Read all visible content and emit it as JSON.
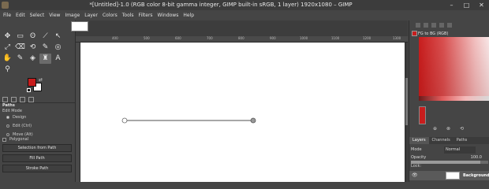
{
  "window": {
    "title": "*[Untitled]-1.0 (RGB color 8-bit gamma integer, GIMP built-in sRGB, 1 layer) 1920x1080 – GIMP",
    "controls": [
      "–",
      "□",
      "✕"
    ]
  },
  "menu": [
    "File",
    "Edit",
    "Select",
    "View",
    "Image",
    "Layer",
    "Colors",
    "Tools",
    "Filters",
    "Windows",
    "Help"
  ],
  "toolbox": {
    "tools": [
      "✥",
      "▭",
      "ʘ",
      "⟋",
      "↖",
      "⤢",
      "⌫",
      "⟲",
      "✎",
      "◎",
      "✋",
      "✎",
      "◈",
      "♜",
      "A",
      "⚲",
      "",
      "",
      "",
      ""
    ],
    "active_tool_index": 13,
    "fg_color": "#c81d1d",
    "bg_color": "#ffffff"
  },
  "tool_options": {
    "title": "Paths",
    "edit_mode_label": "Edit Mode",
    "modes": [
      "Design",
      "Edit (Ctrl)",
      "Move (Alt)"
    ],
    "polygonal_label": "Polygonal",
    "buttons": [
      "Selection from Path",
      "Fill Path",
      "Stroke Path"
    ]
  },
  "canvas": {
    "ruler_labels": [
      "400",
      "500",
      "600",
      "700",
      "800",
      "900",
      "1000",
      "1100",
      "1200",
      "1300"
    ],
    "path": {
      "start": "",
      "end": ""
    }
  },
  "dock": {
    "color_panel_label": "FG to BG (RGB)",
    "color_panel_color": "#c81d1d",
    "tabs": [
      "Layers",
      "Channels",
      "Paths"
    ],
    "mode_label": "Mode",
    "mode_value": "Normal",
    "opacity_label": "Opacity",
    "opacity_value": "100.0",
    "lock_label": "Lock:",
    "layer_name": "Background"
  }
}
